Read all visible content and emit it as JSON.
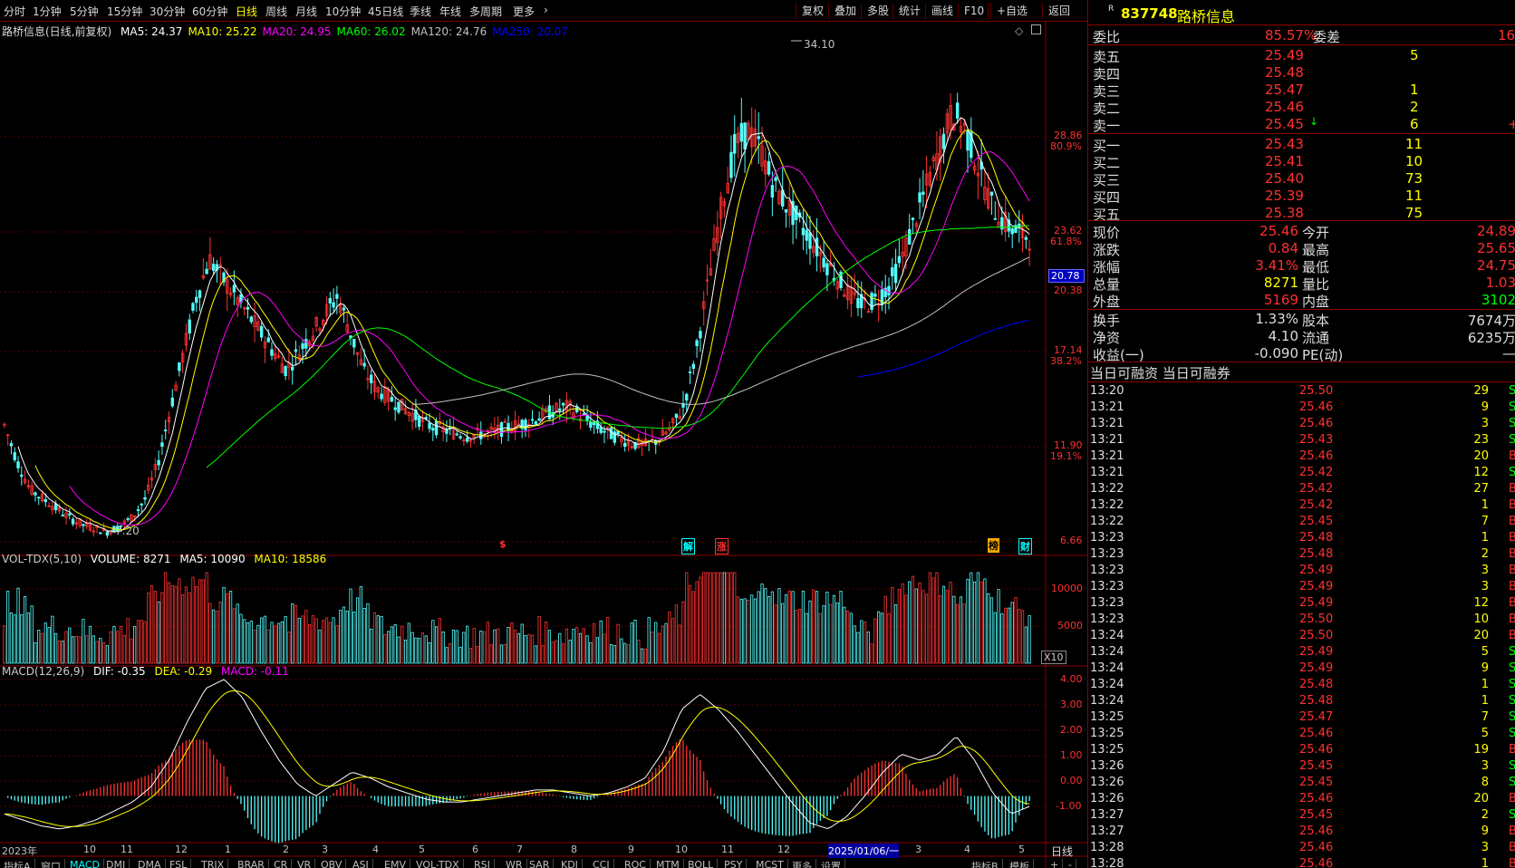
{
  "periods": [
    "分时",
    "1分钟",
    "5分钟",
    "15分钟",
    "30分钟",
    "60分钟",
    "日线",
    "周线",
    "月线",
    "10分钟",
    "45日线",
    "季线",
    "年线",
    "多周期",
    "更多"
  ],
  "active_period": "日线",
  "tools": [
    "复权",
    "叠加",
    "多股",
    "统计",
    "画线",
    "F10",
    "+自选",
    "返回"
  ],
  "stock": {
    "code": "837748",
    "name": "路桥信息",
    "prefix": "R"
  },
  "chart_title": "路桥信息(日线,前复权)",
  "ma_legend": [
    {
      "label": "MA5: 24.37",
      "color": "#ffffff"
    },
    {
      "label": "MA10: 25.22",
      "color": "#ffff00"
    },
    {
      "label": "MA20: 24.95",
      "color": "#ff00ff"
    },
    {
      "label": "MA60: 26.02",
      "color": "#00ff00"
    },
    {
      "label": "MA120: 24.76",
      "color": "#c0c0c0"
    },
    {
      "label": "MA250: 20.07",
      "color": "#0000ff"
    }
  ],
  "price_axis": [
    {
      "price": "28.86",
      "pct": "80.9%"
    },
    {
      "price": "23.62",
      "pct": "61.8%"
    },
    {
      "price": "20.38",
      "pct": ""
    },
    {
      "price": "17.14",
      "pct": "38.2%"
    },
    {
      "price": "11.90",
      "pct": "19.1%"
    },
    {
      "price": "6.66",
      "pct": ""
    }
  ],
  "current_price_tag": "20.78",
  "peak_label": "34.10",
  "low_label": "7.20",
  "event_marks": [
    {
      "text": "$",
      "color": "#ff3030"
    },
    {
      "text": "解",
      "color": "#00ffff"
    },
    {
      "text": "涨",
      "color": "#ff3030"
    },
    {
      "text": "榜",
      "color": "#ffaa00"
    },
    {
      "text": "财",
      "color": "#00ffff"
    }
  ],
  "volume_legend": {
    "name": "VOL-TDX(5,10)",
    "volume": "VOLUME: 8271",
    "ma5": "MA5: 10090",
    "ma10": "MA10: 18586"
  },
  "volume_axis": [
    "10000",
    "5000"
  ],
  "volume_unit": "X10",
  "macd_legend": {
    "name": "MACD(12,26,9)",
    "dif": "DIF: -0.35",
    "dea": "DEA: -0.29",
    "macd": "MACD: -0.11"
  },
  "macd_axis": [
    "4.00",
    "3.00",
    "2.00",
    "1.00",
    "0.00",
    "-1.00"
  ],
  "date_axis": [
    "2023年",
    "10",
    "11",
    "12",
    "1",
    "2",
    "3",
    "4",
    "5",
    "6",
    "7",
    "8",
    "9",
    "10",
    "11",
    "12",
    "2025/01/06/一",
    "3",
    "4",
    "5"
  ],
  "period_tag": "日线",
  "bottom_tabs": [
    "指标A",
    "窗口",
    "MACD",
    "DMI",
    "DMA",
    "FSL",
    "TRIX",
    "BRAR",
    "CR",
    "VR",
    "OBV",
    "ASI",
    "EMV",
    "VOL-TDX",
    "RSI",
    "WR",
    "SAR",
    "KDJ",
    "CCI",
    "ROC",
    "MTM",
    "BOLL",
    "PSY",
    "MCST",
    "更多",
    "设置"
  ],
  "bottom_right": [
    "指标B",
    "模板",
    "+",
    "-"
  ],
  "order_book": {
    "weibi_label": "委比",
    "weibi": "85.57%",
    "weicha_label": "委差",
    "weicha": "16",
    "asks": [
      {
        "label": "卖五",
        "price": "25.49",
        "vol": "5",
        "extra": ""
      },
      {
        "label": "卖四",
        "price": "25.48",
        "vol": "",
        "extra": ""
      },
      {
        "label": "卖三",
        "price": "25.47",
        "vol": "1",
        "extra": ""
      },
      {
        "label": "卖二",
        "price": "25.46",
        "vol": "2",
        "extra": ""
      },
      {
        "label": "卖一",
        "price": "25.45",
        "vol": "6",
        "extra": "+"
      }
    ],
    "bids": [
      {
        "label": "买一",
        "price": "25.43",
        "vol": "11"
      },
      {
        "label": "买二",
        "price": "25.41",
        "vol": "10"
      },
      {
        "label": "买三",
        "price": "25.40",
        "vol": "73"
      },
      {
        "label": "买四",
        "price": "25.39",
        "vol": "11"
      },
      {
        "label": "买五",
        "price": "25.38",
        "vol": "75"
      }
    ]
  },
  "quote": [
    {
      "l1": "现价",
      "v1": "25.46",
      "l2": "今开",
      "v2": "24.89",
      "c1": "#ff3030",
      "c2": "#ff3030"
    },
    {
      "l1": "涨跌",
      "v1": "0.84",
      "l2": "最高",
      "v2": "25.65",
      "c1": "#ff3030",
      "c2": "#ff3030"
    },
    {
      "l1": "涨幅",
      "v1": "3.41%",
      "l2": "最低",
      "v2": "24.75",
      "c1": "#ff3030",
      "c2": "#ff3030"
    },
    {
      "l1": "总量",
      "v1": "8271",
      "l2": "量比",
      "v2": "1.03",
      "c1": "#ffff00",
      "c2": "#ff3030"
    },
    {
      "l1": "外盘",
      "v1": "5169",
      "l2": "内盘",
      "v2": "3102",
      "c1": "#ff3030",
      "c2": "#00ff00"
    }
  ],
  "fundamentals": [
    {
      "l1": "换手",
      "v1": "1.33%",
      "l2": "股本",
      "v2": "7674万"
    },
    {
      "l1": "净资",
      "v1": "4.10",
      "l2": "流通",
      "v2": "6235万"
    },
    {
      "l1": "收益(一)",
      "v1": "-0.090",
      "l2": "PE(动)",
      "v2": "—"
    }
  ],
  "margin_title": "当日可融资 当日可融券",
  "ticks": [
    {
      "t": "13:20",
      "p": "25.50",
      "v": "29",
      "s": "S"
    },
    {
      "t": "13:21",
      "p": "25.46",
      "v": "9",
      "s": "S"
    },
    {
      "t": "13:21",
      "p": "25.46",
      "v": "3",
      "s": "S"
    },
    {
      "t": "13:21",
      "p": "25.43",
      "v": "23",
      "s": "S"
    },
    {
      "t": "13:21",
      "p": "25.46",
      "v": "20",
      "s": "B"
    },
    {
      "t": "13:21",
      "p": "25.42",
      "v": "12",
      "s": "S"
    },
    {
      "t": "13:22",
      "p": "25.42",
      "v": "27",
      "s": "B"
    },
    {
      "t": "13:22",
      "p": "25.42",
      "v": "1",
      "s": "B"
    },
    {
      "t": "13:22",
      "p": "25.45",
      "v": "7",
      "s": "B"
    },
    {
      "t": "13:23",
      "p": "25.48",
      "v": "1",
      "s": "B"
    },
    {
      "t": "13:23",
      "p": "25.48",
      "v": "2",
      "s": "B"
    },
    {
      "t": "13:23",
      "p": "25.49",
      "v": "3",
      "s": "B"
    },
    {
      "t": "13:23",
      "p": "25.49",
      "v": "3",
      "s": "B"
    },
    {
      "t": "13:23",
      "p": "25.49",
      "v": "12",
      "s": "B"
    },
    {
      "t": "13:23",
      "p": "25.50",
      "v": "10",
      "s": "B"
    },
    {
      "t": "13:24",
      "p": "25.50",
      "v": "20",
      "s": "B"
    },
    {
      "t": "13:24",
      "p": "25.49",
      "v": "5",
      "s": "S"
    },
    {
      "t": "13:24",
      "p": "25.49",
      "v": "9",
      "s": "S"
    },
    {
      "t": "13:24",
      "p": "25.48",
      "v": "1",
      "s": "S"
    },
    {
      "t": "13:24",
      "p": "25.48",
      "v": "1",
      "s": "S"
    },
    {
      "t": "13:25",
      "p": "25.47",
      "v": "7",
      "s": "S"
    },
    {
      "t": "13:25",
      "p": "25.46",
      "v": "5",
      "s": "S"
    },
    {
      "t": "13:25",
      "p": "25.46",
      "v": "19",
      "s": "B"
    },
    {
      "t": "13:26",
      "p": "25.45",
      "v": "3",
      "s": "S"
    },
    {
      "t": "13:26",
      "p": "25.45",
      "v": "8",
      "s": "S"
    },
    {
      "t": "13:26",
      "p": "25.46",
      "v": "20",
      "s": "B"
    },
    {
      "t": "13:27",
      "p": "25.45",
      "v": "2",
      "s": "S"
    },
    {
      "t": "13:27",
      "p": "25.46",
      "v": "9",
      "s": "B"
    },
    {
      "t": "13:28",
      "p": "25.46",
      "v": "3",
      "s": "B"
    },
    {
      "t": "13:28",
      "p": "25.46",
      "v": "1",
      "s": "B"
    }
  ],
  "chart_data": {
    "type": "candlestick",
    "price_range": [
      6.66,
      34.1
    ],
    "close_series": [
      13,
      11,
      9.5,
      9,
      8.5,
      8,
      7.6,
      7.4,
      7.2,
      7.5,
      8,
      9,
      11,
      14,
      17,
      20,
      22,
      21,
      20,
      19,
      18,
      17,
      16,
      17,
      18,
      19,
      20,
      18,
      16,
      15,
      14.5,
      14,
      13.5,
      13,
      12.8,
      12.6,
      12.4,
      12.5,
      12.6,
      12.8,
      13,
      13.2,
      13.5,
      13.8,
      14,
      13.5,
      13,
      12.6,
      12.3,
      12,
      11.9,
      12.2,
      12.8,
      14,
      17,
      21,
      25,
      28,
      29,
      28,
      26,
      25,
      24,
      23,
      22,
      21,
      20,
      19.5,
      19.8,
      20.5,
      22,
      24,
      26,
      28,
      30,
      29,
      27,
      25,
      24,
      23.5,
      23.2
    ],
    "volume_range": [
      0,
      12000
    ],
    "macd_range": [
      -1.5,
      4.2
    ],
    "dif_series": [
      -0.6,
      -0.8,
      -1.0,
      -1.1,
      -1.0,
      -0.8,
      -0.5,
      -0.2,
      0.3,
      1.2,
      2.5,
      3.6,
      3.9,
      3.3,
      2.2,
      1.2,
      0.4,
      0,
      0.4,
      0.8,
      0.6,
      0.3,
      0.1,
      -0.1,
      -0.2,
      -0.2,
      -0.1,
      0,
      0.1,
      0.2,
      0.2,
      0.1,
      0,
      0.1,
      0.3,
      0.6,
      1.5,
      2.9,
      3.4,
      2.9,
      2.2,
      1.4,
      0.6,
      -0.2,
      -0.9,
      -1.1,
      -0.7,
      0,
      0.8,
      1.4,
      1.2,
      1.4,
      2.0,
      1.2,
      0.1,
      -0.6,
      -0.35
    ]
  }
}
